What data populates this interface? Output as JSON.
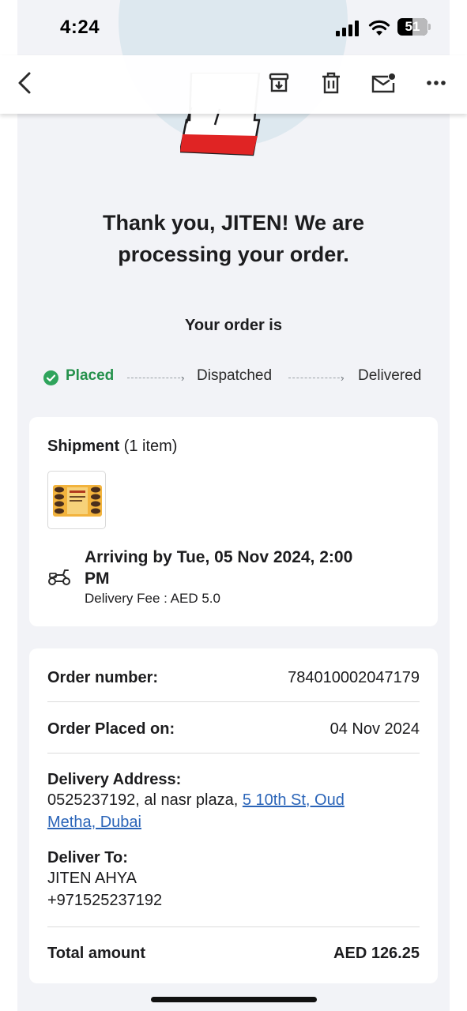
{
  "status_bar": {
    "time": "4:24",
    "battery": "51"
  },
  "toolbar": {
    "icons": [
      "back-icon",
      "archive-icon",
      "trash-icon",
      "mark-unread-icon",
      "more-icon"
    ]
  },
  "hero": {
    "headline_line1": "Thank you, JITEN! We are",
    "headline_line2": "processing your order."
  },
  "tracker": {
    "title": "Your order is",
    "steps": [
      {
        "label": "Placed",
        "state": "done"
      },
      {
        "label": "Dispatched",
        "state": "pending"
      },
      {
        "label": "Delivered",
        "state": "pending"
      }
    ],
    "active_color": "#25914c"
  },
  "shipment": {
    "title": "Shipment",
    "count": "(1 item)",
    "arriving_line1": "Arriving by Tue, 05 Nov 2024, 2:00",
    "arriving_line2": "PM",
    "fee": "Delivery Fee : AED 5.0"
  },
  "order": {
    "number_label": "Order number:",
    "number_value": "784010002047179",
    "placed_label": "Order Placed on:",
    "placed_value": "04 Nov 2024",
    "address_label": "Delivery Address:",
    "address_plain": "0525237192, al nasr plaza, ",
    "address_link_1": "5 10th St, Oud",
    "address_link_2": "Metha, Dubai",
    "deliver_to_label": "Deliver To:",
    "deliver_to_name": "JITEN AHYA",
    "deliver_to_phone": "+971525237192",
    "total_label": "Total amount",
    "total_value": "AED 126.25"
  },
  "colors": {
    "link": "#2a64b8",
    "page_bg": "#f2f3f7",
    "accent_red": "#e02424"
  }
}
